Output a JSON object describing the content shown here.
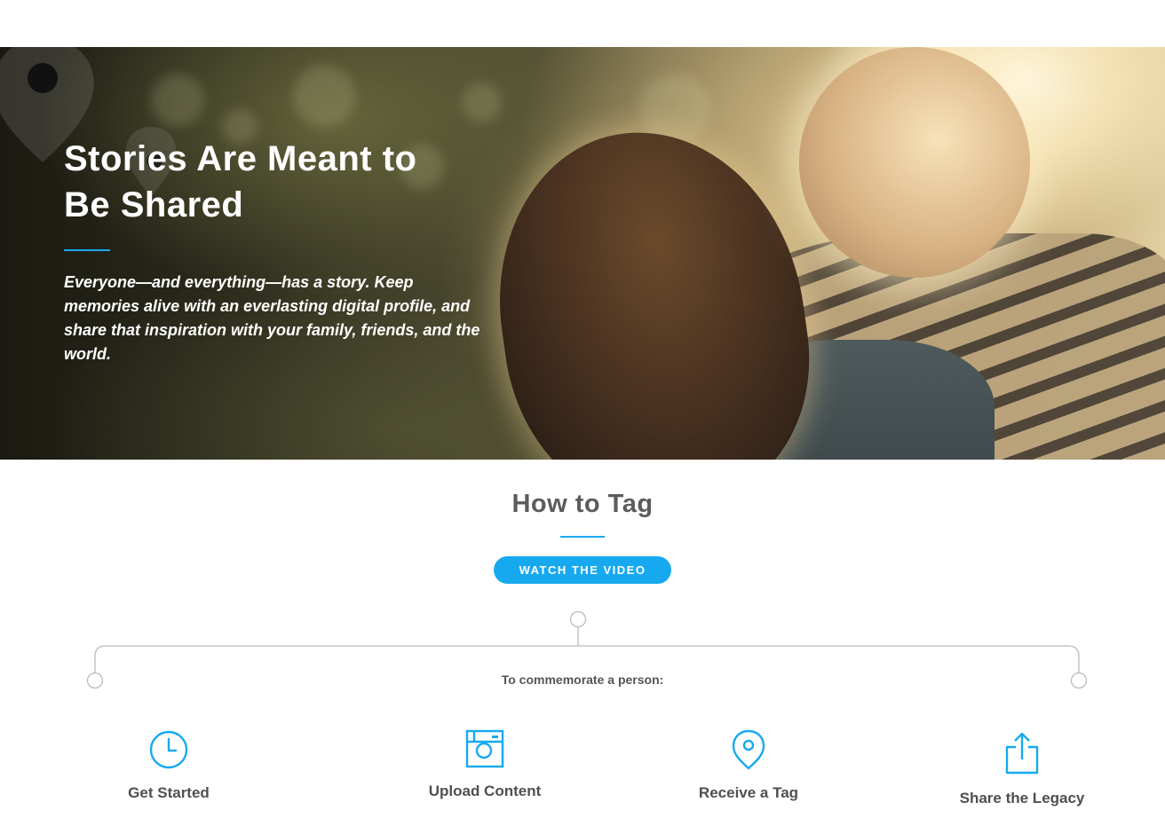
{
  "hero": {
    "title_line1": "Stories Are Meant to",
    "title_line2": "Be Shared",
    "description": "Everyone—and everything—has a story. Keep memories alive with an everlasting digital profile, and share that inspiration with your family, friends, and the world."
  },
  "how_to_tag": {
    "title": "How to Tag",
    "button_label": "WATCH THE VIDEO",
    "branch_label": "To commemorate a person:"
  },
  "steps": [
    {
      "label": "Get Started",
      "icon": "clock-icon"
    },
    {
      "label": "Upload Content",
      "icon": "camera-icon"
    },
    {
      "label": "Receive a Tag",
      "icon": "location-pin-icon"
    },
    {
      "label": "Share the Legacy",
      "icon": "share-icon"
    }
  ],
  "colors": {
    "accent": "#17a9f0",
    "heading_text": "#5c5c5c",
    "body_text": "#4f4f4f",
    "tree_line": "#bbbbbb"
  }
}
